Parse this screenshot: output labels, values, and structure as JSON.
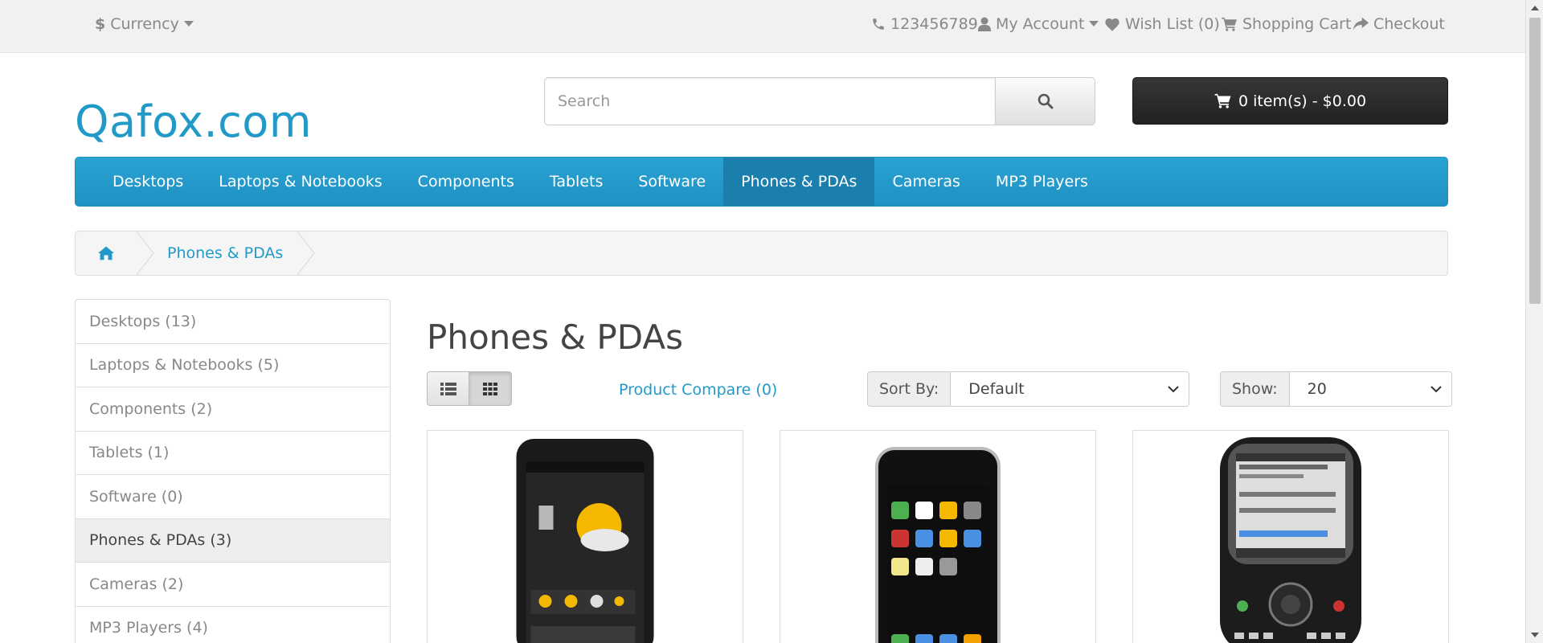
{
  "topbar": {
    "currency_label": "Currency",
    "phone": "123456789",
    "my_account": "My Account",
    "wishlist": "Wish List (0)",
    "shopping_cart": "Shopping Cart",
    "checkout": "Checkout"
  },
  "header": {
    "logo": "Qafox.com",
    "search_placeholder": "Search",
    "cart_label": "0 item(s) - $0.00"
  },
  "menu": {
    "items": [
      {
        "label": "Desktops"
      },
      {
        "label": "Laptops & Notebooks"
      },
      {
        "label": "Components"
      },
      {
        "label": "Tablets"
      },
      {
        "label": "Software"
      },
      {
        "label": "Phones & PDAs"
      },
      {
        "label": "Cameras"
      },
      {
        "label": "MP3 Players"
      }
    ],
    "active": "Phones & PDAs"
  },
  "breadcrumb": {
    "current": "Phones & PDAs"
  },
  "sidebar": {
    "items": [
      {
        "label": "Desktops (13)"
      },
      {
        "label": "Laptops & Notebooks (5)"
      },
      {
        "label": "Components (2)"
      },
      {
        "label": "Tablets (1)"
      },
      {
        "label": "Software (0)"
      },
      {
        "label": "Phones & PDAs (3)"
      },
      {
        "label": "Cameras (2)"
      },
      {
        "label": "MP3 Players (4)"
      }
    ]
  },
  "content": {
    "title": "Phones & PDAs",
    "compare": "Product Compare (0)",
    "sort_label": "Sort By:",
    "sort_value": "Default",
    "show_label": "Show:",
    "show_value": "20"
  },
  "colors": {
    "accent": "#229ac8",
    "menu_active": "#1b7fad"
  }
}
